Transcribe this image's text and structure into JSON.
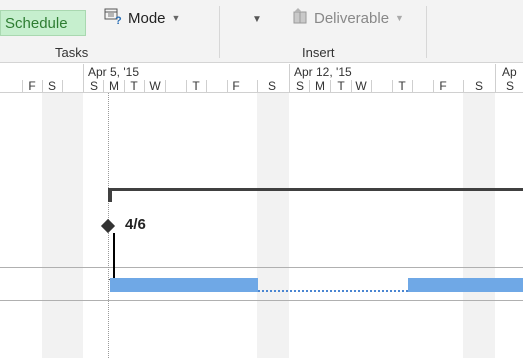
{
  "ribbon": {
    "schedule_label": "Schedule",
    "mode_label": "Mode",
    "mode_icon": "mode-help-icon",
    "deliverable_label": "Deliverable",
    "deliverable_icon": "deliverable-icon",
    "tasks_group_label": "Tasks",
    "insert_group_label": "Insert"
  },
  "timescale": {
    "left_days": [
      "F",
      "S"
    ],
    "week1_label": "Apr 5, '15",
    "week1_days": [
      "S",
      "M",
      "T",
      "W",
      "T",
      "F",
      "S"
    ],
    "week2_label": "Apr 12, '15",
    "week2_days": [
      "S",
      "M",
      "T",
      "W",
      "T",
      "F",
      "S"
    ],
    "week3_label": "Ap",
    "week3_days": [
      "S"
    ]
  },
  "gantt": {
    "milestone_label": "4/6",
    "task_bar_color": "#6fa8e6",
    "summary_color": "#404040",
    "weekend_shade_color": "#f2f2f2"
  }
}
